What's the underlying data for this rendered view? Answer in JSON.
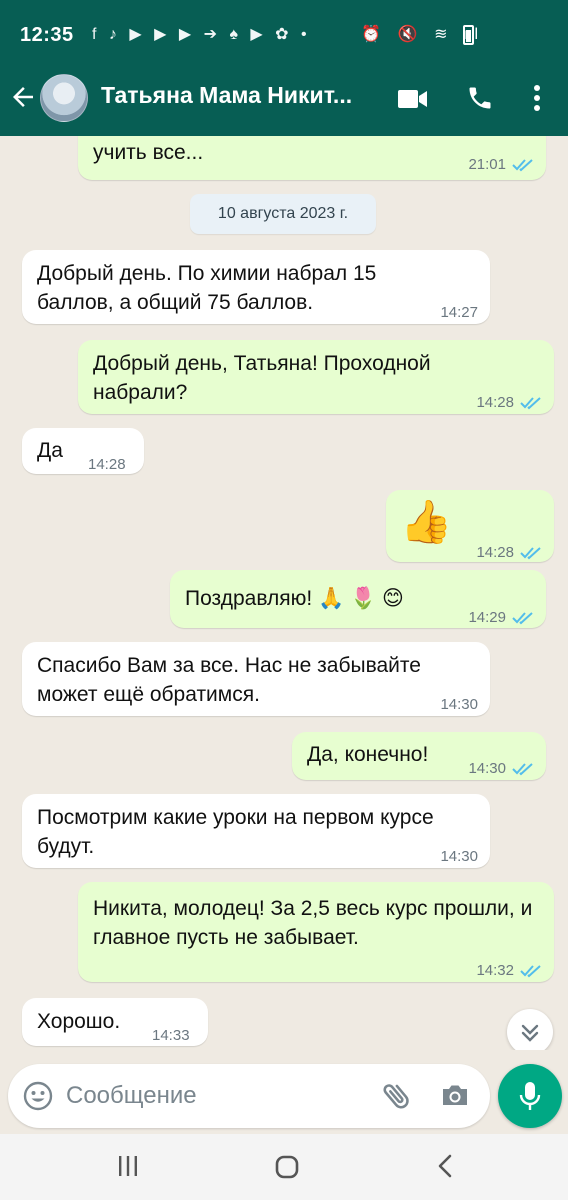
{
  "status_bar": {
    "time": "12:35",
    "left_icons": "f ♪ ▶ ▶ ▶ ➔ ♠ ▶ ✿ •",
    "right_icons": "⏰ 🔇 ≋ ıl"
  },
  "header": {
    "contact_name": "Татьяна Мама Никит...",
    "back_icon": "arrow-left-icon",
    "video_icon": "video-call-icon",
    "call_icon": "phone-icon",
    "menu_icon": "more-vert-icon"
  },
  "colors": {
    "header": "#075e54",
    "incoming": "#ffffff",
    "outgoing": "#e7fed0",
    "read_ticks": "#53bdeb",
    "mic_button": "#00a884"
  },
  "chat": {
    "date_separator": "10 августа 2023 г.",
    "messages": [
      {
        "dir": "out",
        "text": "учить все...",
        "time": "21:01",
        "read": true
      },
      {
        "dir": "in",
        "text": "Добрый день. По химии набрал 15 баллов, а общий 75 баллов.",
        "time": "14:27"
      },
      {
        "dir": "out",
        "text": "Добрый день, Татьяна! Проходной набрали?",
        "time": "14:28",
        "read": true
      },
      {
        "dir": "in",
        "text": "Да",
        "time": "14:28"
      },
      {
        "dir": "out",
        "text": "👍",
        "time": "14:28",
        "read": true
      },
      {
        "dir": "out",
        "text": "Поздравляю! 🙏 🌷 😊",
        "time": "14:29",
        "read": true
      },
      {
        "dir": "in",
        "text": "Спасибо Вам за все. Нас не забывайте может ещё обратимся.",
        "time": "14:30"
      },
      {
        "dir": "out",
        "text": "Да, конечно!",
        "time": "14:30",
        "read": true
      },
      {
        "dir": "in",
        "text": "Посмотрим какие уроки на первом курсе будут.",
        "time": "14:30"
      },
      {
        "dir": "out",
        "text": "Никита, молодец! За 2,5 весь курс прошли, и главное пусть не забывает.",
        "time": "14:32",
        "read": true
      },
      {
        "dir": "in",
        "text": "Хорошо.",
        "time": "14:33"
      }
    ]
  },
  "composer": {
    "placeholder": "Сообщение",
    "emoji_icon": "emoji-icon",
    "attach_icon": "paperclip-icon",
    "camera_icon": "camera-icon",
    "mic_icon": "microphone-icon"
  },
  "scroll_down_icon": "double-chevron-down-icon",
  "nav_bar": {
    "recent_icon": "recent-apps-icon",
    "home_icon": "home-icon",
    "back_icon": "nav-back-icon"
  }
}
